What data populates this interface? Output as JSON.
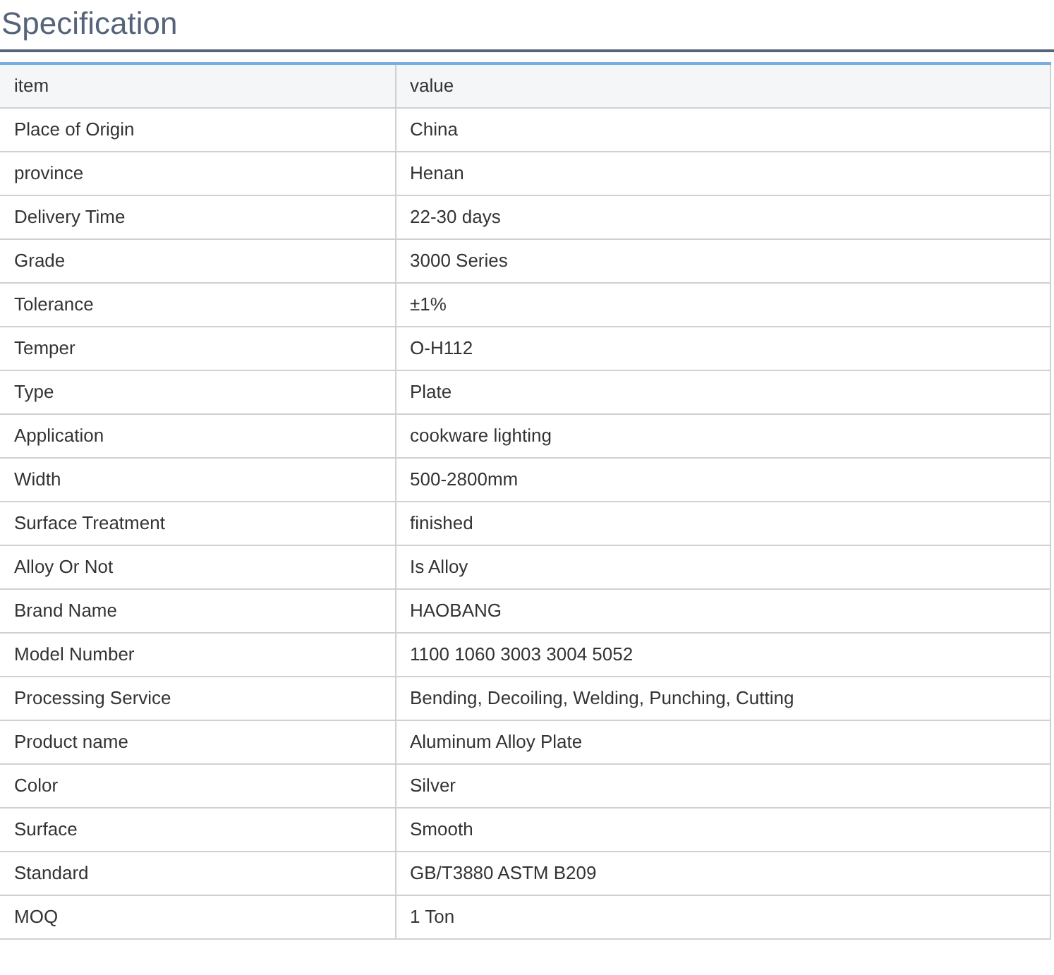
{
  "title": "Specification",
  "table": {
    "columns": [
      "item",
      "value"
    ],
    "rows": [
      [
        "Place of Origin",
        "China"
      ],
      [
        "province",
        "Henan"
      ],
      [
        "Delivery Time",
        "22-30 days"
      ],
      [
        "Grade",
        "3000 Series"
      ],
      [
        "Tolerance",
        "±1%"
      ],
      [
        "Temper",
        "O-H112"
      ],
      [
        "Type",
        "Plate"
      ],
      [
        "Application",
        "cookware lighting"
      ],
      [
        "Width",
        "500-2800mm"
      ],
      [
        "Surface Treatment",
        "finished"
      ],
      [
        "Alloy Or Not",
        "Is Alloy"
      ],
      [
        "Brand Name",
        "HAOBANG"
      ],
      [
        "Model Number",
        "1100 1060 3003 3004 5052"
      ],
      [
        "Processing Service",
        "Bending, Decoiling, Welding, Punching, Cutting"
      ],
      [
        "Product name",
        "Aluminum Alloy Plate"
      ],
      [
        "Color",
        "Silver"
      ],
      [
        "Surface",
        "Smooth"
      ],
      [
        "Standard",
        "GB/T3880 ASTM B209"
      ],
      [
        "MOQ",
        "1 Ton"
      ]
    ]
  }
}
